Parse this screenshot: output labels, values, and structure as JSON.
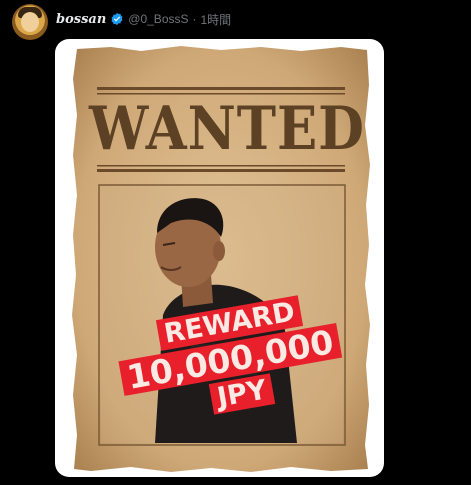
{
  "tweet": {
    "display_name": "bossan",
    "handle": "@0_BossS",
    "separator": "·",
    "time": "1時間"
  },
  "icons": {
    "avatar": "avatar-image",
    "verified": "verified-badge-icon"
  },
  "colors": {
    "background": "#000000",
    "name": "#e7e9ea",
    "meta": "#71767b",
    "verified": "#1d9bf0",
    "stamp": "#e8202b",
    "parchment": "#d9b98c",
    "ink": "#5d4124"
  },
  "poster": {
    "heading": "WANTED",
    "stamp_reward": "REWARD",
    "stamp_amount": "10,000,000",
    "stamp_currency": "JPY"
  }
}
